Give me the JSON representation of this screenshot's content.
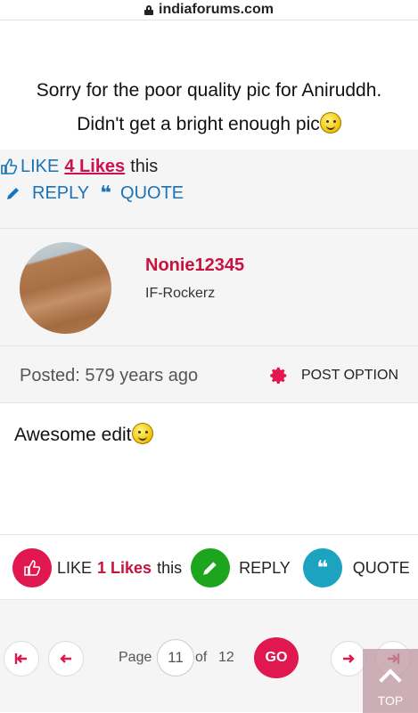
{
  "browser": {
    "url": "indiaforums.com"
  },
  "post1": {
    "line1": "Sorry for the poor quality pic for Aniruddh.",
    "line2": "Didn't get a bright enough pic"
  },
  "actions1": {
    "like_label": "LIKE",
    "likes_count": "4 Likes",
    "likes_suffix": "this",
    "reply_label": "REPLY",
    "quote_label": "QUOTE"
  },
  "user": {
    "name": "Nonie12345",
    "rank": "IF-Rockerz"
  },
  "meta": {
    "posted": "Posted: 579 years ago",
    "post_option": "POST OPTION"
  },
  "post2": {
    "text": "Awesome edit"
  },
  "actions2": {
    "like_label": "LIKE",
    "likes_count": "1 Likes",
    "likes_suffix": "this",
    "reply_label": "REPLY",
    "quote_label": "QUOTE"
  },
  "pager": {
    "page_label": "Page",
    "current_page": "11",
    "of_label": "of",
    "total_pages": "12",
    "go_label": "GO",
    "top_label": "TOP"
  },
  "colors": {
    "accent": "#e0184f",
    "link_blue": "#1a73b8",
    "reply_green": "#1ea51e",
    "quote_teal": "#1ba3c0"
  }
}
